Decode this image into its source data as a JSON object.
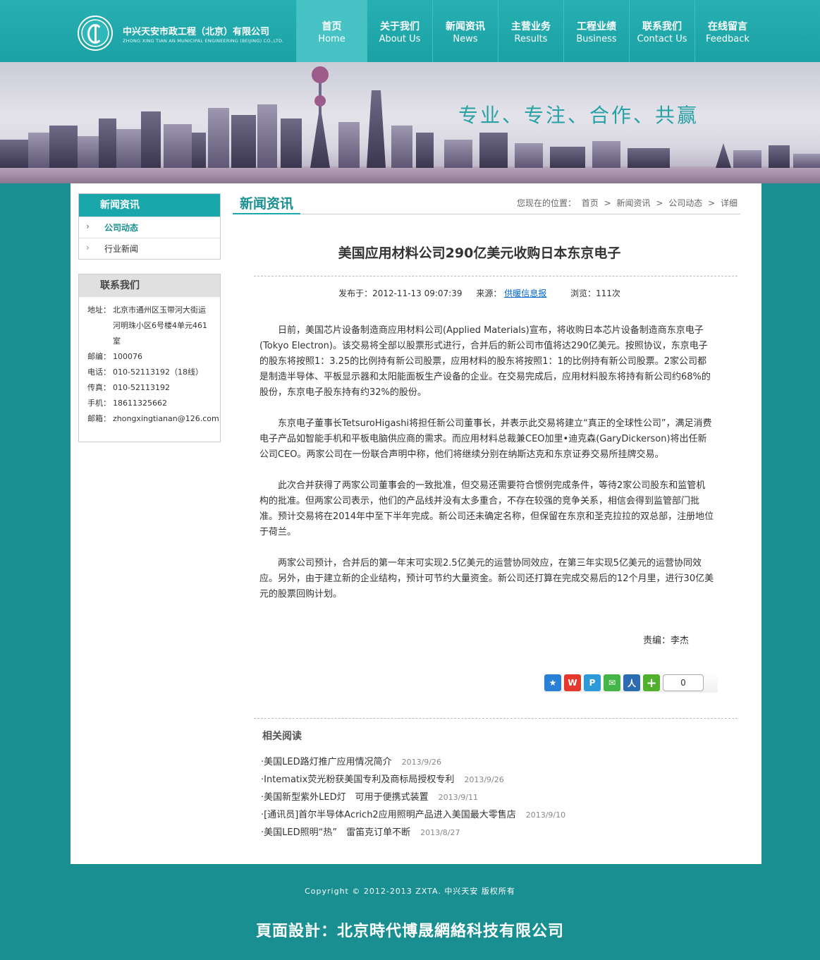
{
  "header": {
    "logo_cn": "中兴天安市政工程（北京）有限公司",
    "logo_en": "ZHONG XING TIAN AN MUNICIPAL ENGINEERING (BEIJING) CO.,LTD."
  },
  "nav": [
    {
      "cn": "首页",
      "en": "Home"
    },
    {
      "cn": "关于我们",
      "en": "About Us"
    },
    {
      "cn": "新闻资讯",
      "en": "News"
    },
    {
      "cn": "主营业务",
      "en": "Results"
    },
    {
      "cn": "工程业绩",
      "en": "Business"
    },
    {
      "cn": "联系我们",
      "en": "Contact Us"
    },
    {
      "cn": "在线留言",
      "en": "Feedback"
    }
  ],
  "banner": {
    "slogan": "专业、专注、合作、共赢"
  },
  "sidebar": {
    "news_title": "新闻资讯",
    "news_items": [
      "公司动态",
      "行业新闻"
    ],
    "contact_title": "联系我们",
    "contact": [
      {
        "label": "地址：",
        "value": "北京市通州区玉带河大街运河明珠小区6号楼4单元461室"
      },
      {
        "label": "邮编：",
        "value": "100076"
      },
      {
        "label": "电话：",
        "value": "010-52113192（18线）"
      },
      {
        "label": "传真：",
        "value": "010-52113192"
      },
      {
        "label": "手机：",
        "value": "18611325662"
      },
      {
        "label": "邮箱：",
        "value": "zhongxingtianan@126.com"
      }
    ]
  },
  "content": {
    "section_title": "新闻资讯",
    "breadcrumb": [
      "您现在的位置：",
      "首页",
      ">",
      "新闻资讯",
      ">",
      "公司动态",
      ">",
      "详细"
    ]
  },
  "article": {
    "title": "美国应用材料公司290亿美元收购日本东京电子",
    "published": "发布于：2012-11-13 09:07:39",
    "source_label": "来源：",
    "source": "供暖信息报",
    "views": "浏览：111次",
    "paragraphs": [
      "日前，美国芯片设备制造商应用材料公司(Applied Materials)宣布，将收购日本芯片设备制造商东京电子(Tokyo Electron)。该交易将全部以股票形式进行，合并后的新公司市值将达290亿美元。按照协议，东京电子的股东将按照1：3.25的比例持有新公司股票，应用材料的股东将按照1：1的比例持有新公司股票。2家公司都是制造半导体、平板显示器和太阳能面板生产设备的企业。在交易完成后，应用材料股东将持有新公司约68%的股份，东京电子股东持有约32%的股份。",
      "东京电子董事长TetsuroHigashi将担任新公司董事长，并表示此交易将建立“真正的全球性公司”，满足消费电子产品如智能手机和平板电脑供应商的需求。而应用材料总裁兼CEO加里•迪克森(GaryDickerson)将出任新公司CEO。两家公司在一份联合声明中称，他们将继续分别在纳斯达克和东京证券交易所挂牌交易。",
      "此次合并获得了两家公司董事会的一致批准，但交易还需要符合惯例完成条件，等待2家公司股东和监管机构的批准。但两家公司表示，他们的产品线并没有太多重合，不存在较强的竞争关系，相信会得到监管部门批准。预计交易将在2014年中至下半年完成。新公司还未确定名称，但保留在东京和圣克拉拉的双总部，注册地位于荷兰。",
      "两家公司预计，合并后的第一年末可实现2.5亿美元的运营协同效应，在第三年实现5亿美元的运营协同效应。另外，由于建立新的企业结构，预计可节约大量资金。新公司还打算在完成交易后的12个月里，进行30亿美元的股票回购计划。"
    ],
    "editor": "责编：李杰",
    "share_count": "0"
  },
  "related": {
    "title": "相关阅读",
    "items": [
      {
        "text": "·美国LED路灯推广应用情况简介",
        "date": "2013/9/26"
      },
      {
        "text": "·Intematix荧光粉获美国专利及商标局授权专利",
        "date": "2013/9/26"
      },
      {
        "text": "·美国新型紫外LED灯　可用于便携式装置",
        "date": "2013/9/11"
      },
      {
        "text": "·[通讯员]首尔半导体Acrich2应用照明产品进入美国最大零售店",
        "date": "2013/9/10"
      },
      {
        "text": "·美国LED照明“热”　雷笛克订单不断",
        "date": "2013/8/27"
      }
    ]
  },
  "footer": {
    "copyright": "Copyright © 2012-2013 ZXTA. 中兴天安 版权所有",
    "designer": "頁面設計：北京時代博晟網絡科技有限公司"
  },
  "colors": {
    "teal": "#1aa7ab",
    "background": "#1a8f91"
  }
}
